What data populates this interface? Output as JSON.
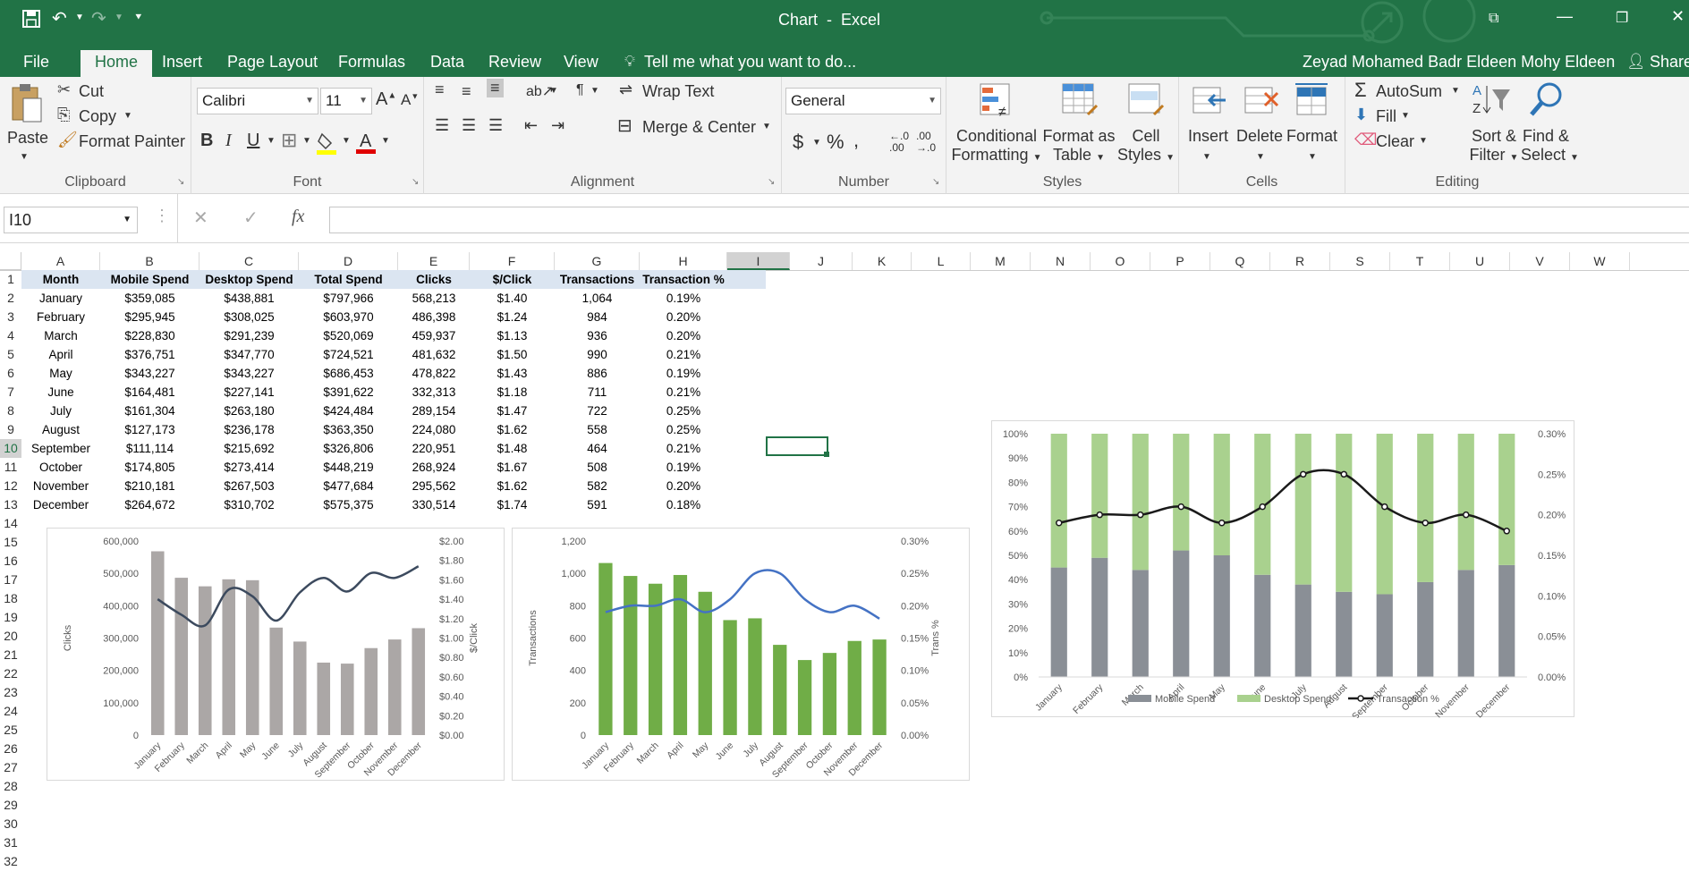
{
  "window": {
    "title": "Chart  -  Excel",
    "user": "Zeyad Mohamed Badr Eldeen Mohy Eldeen",
    "share": "Share"
  },
  "tabs": [
    "File",
    "Home",
    "Insert",
    "Page Layout",
    "Formulas",
    "Data",
    "Review",
    "View"
  ],
  "tell_me": "Tell me what you want to do...",
  "ribbon": {
    "clipboard": {
      "paste": "Paste",
      "cut": "Cut",
      "copy": "Copy",
      "format_painter": "Format Painter",
      "label": "Clipboard"
    },
    "font": {
      "name": "Calibri",
      "size": "11",
      "label": "Font"
    },
    "alignment": {
      "wrap": "Wrap Text",
      "merge": "Merge & Center",
      "label": "Alignment"
    },
    "number": {
      "format": "General",
      "label": "Number"
    },
    "styles": {
      "conditional": "Conditional",
      "conditional2": "Formatting",
      "format_as": "Format as",
      "format_as2": "Table",
      "cell": "Cell",
      "cell2": "Styles",
      "label": "Styles"
    },
    "cells": {
      "insert": "Insert",
      "delete": "Delete",
      "format": "Format",
      "label": "Cells"
    },
    "editing": {
      "autosum": "AutoSum",
      "fill": "Fill",
      "clear": "Clear",
      "sort": "Sort &",
      "sort2": "Filter",
      "find": "Find &",
      "find2": "Select",
      "label": "Editing"
    }
  },
  "formula_bar": {
    "name_box": "I10",
    "fx": "fx"
  },
  "columns": [
    "A",
    "B",
    "C",
    "D",
    "E",
    "F",
    "G",
    "H",
    "I",
    "J",
    "K",
    "L",
    "M",
    "N",
    "O",
    "P",
    "Q",
    "R",
    "S",
    "T",
    "U",
    "V",
    "W"
  ],
  "rows": [
    "1",
    "2",
    "3",
    "4",
    "5",
    "6",
    "7",
    "8",
    "9",
    "10",
    "11",
    "12",
    "13",
    "14",
    "15",
    "16",
    "17",
    "18",
    "19",
    "20",
    "21",
    "22",
    "23",
    "24",
    "25",
    "26",
    "27",
    "28",
    "29",
    "30",
    "31",
    "32"
  ],
  "table": {
    "headers": [
      "Month",
      "Mobile Spend",
      "Desktop Spend",
      "Total Spend",
      "Clicks",
      "$/Click",
      "Transactions",
      "Transaction %"
    ],
    "rows": [
      [
        "January",
        "$359,085",
        "$438,881",
        "$797,966",
        "568,213",
        "$1.40",
        "1,064",
        "0.19%"
      ],
      [
        "February",
        "$295,945",
        "$308,025",
        "$603,970",
        "486,398",
        "$1.24",
        "984",
        "0.20%"
      ],
      [
        "March",
        "$228,830",
        "$291,239",
        "$520,069",
        "459,937",
        "$1.13",
        "936",
        "0.20%"
      ],
      [
        "April",
        "$376,751",
        "$347,770",
        "$724,521",
        "481,632",
        "$1.50",
        "990",
        "0.21%"
      ],
      [
        "May",
        "$343,227",
        "$343,227",
        "$686,453",
        "478,822",
        "$1.43",
        "886",
        "0.19%"
      ],
      [
        "June",
        "$164,481",
        "$227,141",
        "$391,622",
        "332,313",
        "$1.18",
        "711",
        "0.21%"
      ],
      [
        "July",
        "$161,304",
        "$263,180",
        "$424,484",
        "289,154",
        "$1.47",
        "722",
        "0.25%"
      ],
      [
        "August",
        "$127,173",
        "$236,178",
        "$363,350",
        "224,080",
        "$1.62",
        "558",
        "0.25%"
      ],
      [
        "September",
        "$111,114",
        "$215,692",
        "$326,806",
        "220,951",
        "$1.48",
        "464",
        "0.21%"
      ],
      [
        "October",
        "$174,805",
        "$273,414",
        "$448,219",
        "268,924",
        "$1.67",
        "508",
        "0.19%"
      ],
      [
        "November",
        "$210,181",
        "$267,503",
        "$477,684",
        "295,562",
        "$1.62",
        "582",
        "0.20%"
      ],
      [
        "December",
        "$264,672",
        "$310,702",
        "$575,375",
        "330,514",
        "$1.74",
        "591",
        "0.18%"
      ]
    ]
  },
  "chart_data": [
    {
      "type": "bar",
      "categories": [
        "January",
        "February",
        "March",
        "April",
        "May",
        "June",
        "July",
        "August",
        "September",
        "October",
        "November",
        "December"
      ],
      "series": [
        {
          "values": [
            568213,
            486398,
            459937,
            481632,
            478822,
            332313,
            289154,
            224080,
            220951,
            268924,
            295562,
            330514
          ],
          "color": "#aba7a6"
        },
        {
          "type": "line",
          "axis": "secondary",
          "values": [
            1.4,
            1.24,
            1.13,
            1.5,
            1.43,
            1.18,
            1.47,
            1.62,
            1.48,
            1.67,
            1.62,
            1.74
          ],
          "color": "#3c4a5e"
        }
      ],
      "ylabel": "Clicks",
      "y2label": "$/Click",
      "yticks": [
        "600,000",
        "500,000",
        "400,000",
        "300,000",
        "200,000",
        "100,000",
        "0"
      ],
      "y2ticks": [
        "$2.00",
        "$1.80",
        "$1.60",
        "$1.40",
        "$1.20",
        "$1.00",
        "$0.80",
        "$0.60",
        "$0.40",
        "$0.20",
        "$0.00"
      ],
      "ylim": [
        0,
        600000
      ],
      "y2lim": [
        0,
        2.0
      ]
    },
    {
      "type": "bar",
      "categories": [
        "January",
        "February",
        "March",
        "April",
        "May",
        "June",
        "July",
        "August",
        "September",
        "October",
        "November",
        "December"
      ],
      "series": [
        {
          "values": [
            1064,
            984,
            936,
            990,
            886,
            711,
            722,
            558,
            464,
            508,
            582,
            591
          ],
          "color": "#70ad47"
        },
        {
          "type": "line",
          "axis": "secondary",
          "values": [
            0.19,
            0.2,
            0.2,
            0.21,
            0.19,
            0.21,
            0.25,
            0.25,
            0.21,
            0.19,
            0.2,
            0.18
          ],
          "color": "#4472c4"
        }
      ],
      "ylabel": "Transactions",
      "y2label": "Trans %",
      "yticks": [
        "1,200",
        "1,000",
        "800",
        "600",
        "400",
        "200",
        "0"
      ],
      "y2ticks": [
        "0.30%",
        "0.25%",
        "0.20%",
        "0.15%",
        "0.10%",
        "0.05%",
        "0.00%"
      ],
      "ylim": [
        0,
        1200
      ],
      "y2lim": [
        0,
        0.3
      ]
    },
    {
      "type": "bar",
      "stacked": "percent",
      "categories": [
        "January",
        "February",
        "March",
        "April",
        "May",
        "June",
        "July",
        "August",
        "September",
        "October",
        "November",
        "December"
      ],
      "series": [
        {
          "name": "Mobile Spend",
          "values": [
            359085,
            295945,
            228830,
            376751,
            343227,
            164481,
            161304,
            127173,
            111114,
            174805,
            210181,
            264672
          ],
          "color": "#8a8f96"
        },
        {
          "name": "Desktop Spend",
          "values": [
            438881,
            308025,
            291239,
            347770,
            343227,
            227141,
            263180,
            236178,
            215692,
            273414,
            267503,
            310702
          ],
          "color": "#a9d18e"
        },
        {
          "name": "Transaction %",
          "type": "line",
          "axis": "secondary",
          "values": [
            0.19,
            0.2,
            0.2,
            0.21,
            0.19,
            0.21,
            0.25,
            0.25,
            0.21,
            0.19,
            0.2,
            0.18
          ],
          "color": "#1a1a1a"
        }
      ],
      "yticks": [
        "100%",
        "90%",
        "80%",
        "70%",
        "60%",
        "50%",
        "40%",
        "30%",
        "20%",
        "10%",
        "0%"
      ],
      "y2ticks": [
        "0.30%",
        "0.25%",
        "0.20%",
        "0.15%",
        "0.10%",
        "0.05%",
        "0.00%"
      ],
      "ylim": [
        0,
        100
      ],
      "y2lim": [
        0,
        0.3
      ],
      "legend": "bottom"
    }
  ]
}
